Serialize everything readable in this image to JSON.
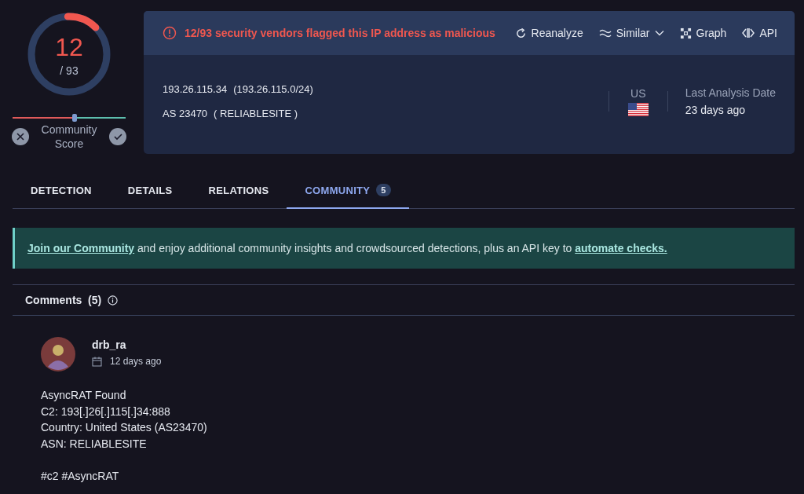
{
  "score": {
    "detections": "12",
    "total": "/ 93",
    "level": 0.13
  },
  "community_score": {
    "label": "Community Score",
    "level": 0.55
  },
  "alert": "12/93 security vendors flagged this IP address as malicious",
  "actions": [
    {
      "label": "Reanalyze"
    },
    {
      "label": "Similar"
    },
    {
      "label": "Graph"
    },
    {
      "label": "API"
    }
  ],
  "ip": {
    "address": "193.26.115.34",
    "range": "(193.26.115.0/24)",
    "as": "AS 23470",
    "owner": "( RELIABLESITE )"
  },
  "country": "US",
  "last_analysis": {
    "label": "Last Analysis Date",
    "value": "23 days ago"
  },
  "tabs": [
    {
      "label": "DETECTION",
      "selected": false
    },
    {
      "label": "DETAILS",
      "selected": false
    },
    {
      "label": "RELATIONS",
      "selected": false
    },
    {
      "label": "COMMUNITY",
      "selected": true,
      "badge": "5"
    }
  ],
  "banner": {
    "link_1": "Join our Community",
    "text": " and enjoy additional community insights and crowdsourced detections, plus an API key to ",
    "link_2": "automate checks."
  },
  "comments_header": {
    "label": "Comments",
    "count": "(5)"
  },
  "comments": [
    {
      "author": "drb_ra",
      "date": "12 days ago",
      "paragraphs": [
        "AsyncRAT Found\nC2: 193[.]26[.]115[.]34:888\nCountry: United States (AS23470)\nASN: RELIABLESITE",
        "#c2 #AsyncRAT"
      ]
    }
  ]
}
